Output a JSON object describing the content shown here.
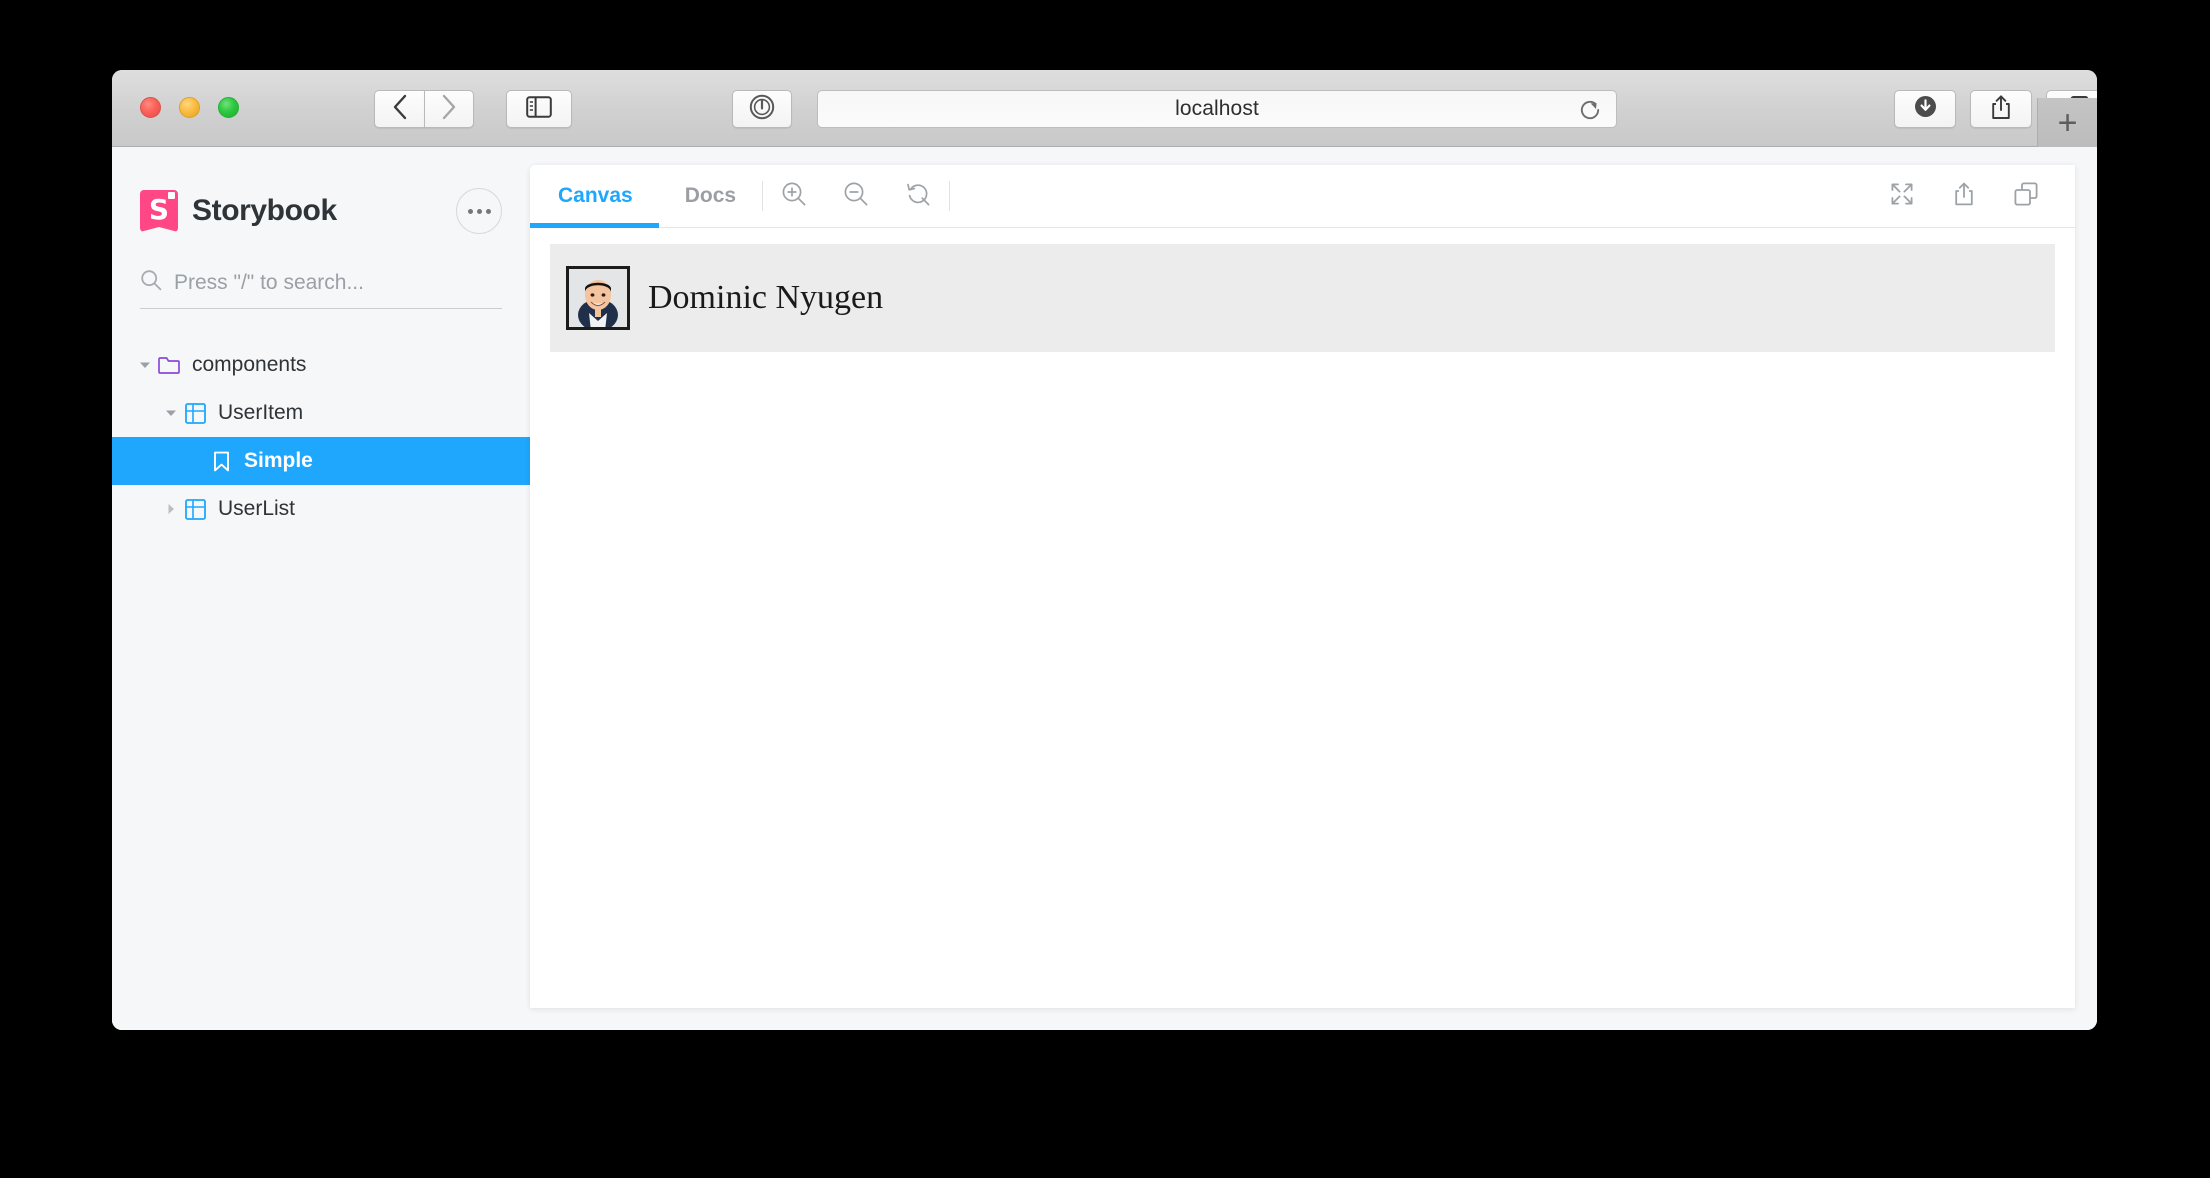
{
  "browser": {
    "url": "localhost",
    "traffic_lights": [
      "close",
      "minimize",
      "zoom"
    ],
    "buttons": {
      "back": "back-icon",
      "forward": "forward-icon",
      "sidebar": "sidebar-toggle-icon",
      "onepassword": "1password-icon",
      "reload": "reload-icon",
      "downloads": "downloads-icon",
      "share": "share-icon",
      "tab_overview": "tab-overview-icon",
      "new_tab": "+"
    }
  },
  "storybook": {
    "brand": {
      "name": "Storybook",
      "logo_color": "#ff4785",
      "logo_letter": "S",
      "menu_icon": "ellipsis-icon"
    },
    "search": {
      "placeholder": "Press \"/\" to search...",
      "value": "",
      "icon": "search-icon"
    },
    "tree": [
      {
        "label": "components",
        "depth": 1,
        "icon": "folder-icon",
        "icon_color": "#6f2cac",
        "expanded": true,
        "selected": false
      },
      {
        "label": "UserItem",
        "depth": 2,
        "icon": "component-icon",
        "icon_color": "#1ea7fd",
        "expanded": true,
        "selected": false
      },
      {
        "label": "Simple",
        "depth": 3,
        "icon": "story-bookmark-icon",
        "icon_color": "#ffffff",
        "expanded": null,
        "selected": true
      },
      {
        "label": "UserList",
        "depth": 2,
        "icon": "component-icon",
        "icon_color": "#1ea7fd",
        "expanded": false,
        "selected": false
      }
    ],
    "selection_color": "#1ea7fd",
    "toolbar": {
      "tabs": [
        {
          "label": "Canvas",
          "active": true
        },
        {
          "label": "Docs",
          "active": false
        }
      ],
      "zoom_in": "zoom-in-icon",
      "zoom_out": "zoom-out-icon",
      "zoom_reset": "zoom-reset-icon",
      "fullscreen": "fullscreen-icon",
      "open_new_tab": "open-in-new-tab-icon",
      "copy_link": "copy-link-icon"
    },
    "preview": {
      "background": "#ececec",
      "user": {
        "name": "Dominic Nyugen",
        "avatar": "user-avatar"
      }
    }
  }
}
